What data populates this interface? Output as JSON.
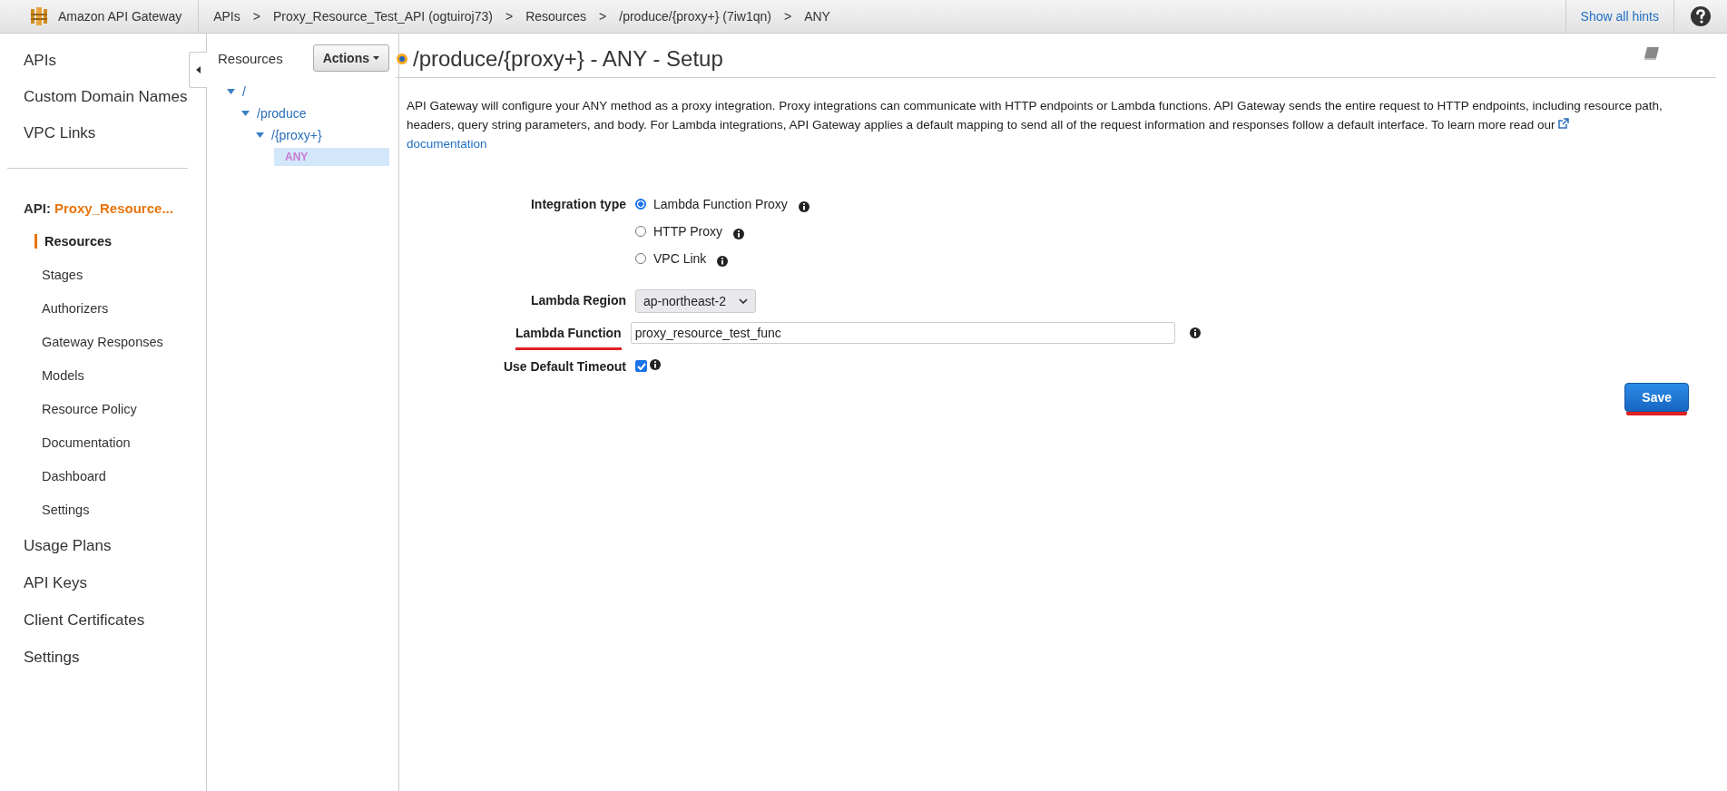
{
  "topbar": {
    "brand": "Amazon API Gateway",
    "breadcrumbs": [
      "APIs",
      "Proxy_Resource_Test_API (ogtuiroj73)",
      "Resources",
      "/produce/{proxy+} (7iw1qn)",
      "ANY"
    ],
    "separator": ">",
    "hints_link": "Show all hints"
  },
  "sidebar": {
    "top_items": [
      "APIs",
      "Custom Domain Names",
      "VPC Links"
    ],
    "api": {
      "label": "API:",
      "name": "Proxy_Resource..."
    },
    "sub_items": [
      {
        "label": "Resources",
        "selected": true
      },
      {
        "label": "Stages",
        "selected": false
      },
      {
        "label": "Authorizers",
        "selected": false
      },
      {
        "label": "Gateway Responses",
        "selected": false
      },
      {
        "label": "Models",
        "selected": false
      },
      {
        "label": "Resource Policy",
        "selected": false
      },
      {
        "label": "Documentation",
        "selected": false
      },
      {
        "label": "Dashboard",
        "selected": false
      },
      {
        "label": "Settings",
        "selected": false
      }
    ],
    "bottom_items": [
      "Usage Plans",
      "API Keys",
      "Client Certificates",
      "Settings"
    ]
  },
  "resources": {
    "title": "Resources",
    "actions_button": "Actions",
    "tree": [
      {
        "label": "/",
        "kind": "resource",
        "expanded": true,
        "selected": false,
        "children": [
          {
            "label": "/produce",
            "kind": "resource",
            "expanded": true,
            "selected": false,
            "children": [
              {
                "label": "/{proxy+}",
                "kind": "resource",
                "expanded": true,
                "selected": false,
                "children": [
                  {
                    "label": "ANY",
                    "kind": "method",
                    "selected": true
                  }
                ]
              }
            ]
          }
        ]
      }
    ]
  },
  "main": {
    "title": "/produce/{proxy+} - ANY - Setup",
    "description": {
      "text": "API Gateway will configure your ANY method as a proxy integration. Proxy integrations can communicate with HTTP endpoints or Lambda functions. API Gateway sends the entire request to HTTP endpoints, including resource path, headers, query string parameters, and body. For Lambda integrations, API Gateway applies a default mapping to send all of the request information and responses follow a default interface. To learn more read our",
      "link": "documentation"
    },
    "integration_type": {
      "label": "Integration type",
      "options": [
        {
          "label": "Lambda Function Proxy",
          "selected": true
        },
        {
          "label": "HTTP Proxy",
          "selected": false
        },
        {
          "label": "VPC Link",
          "selected": false
        }
      ]
    },
    "lambda_region": {
      "label": "Lambda Region",
      "value": "ap-northeast-2"
    },
    "lambda_function": {
      "label": "Lambda Function",
      "value": "proxy_resource_test_func",
      "underlined": true
    },
    "use_default_timeout": {
      "label": "Use Default Timeout",
      "checked": true
    },
    "save_button": {
      "label": "Save",
      "underlined": true
    }
  }
}
